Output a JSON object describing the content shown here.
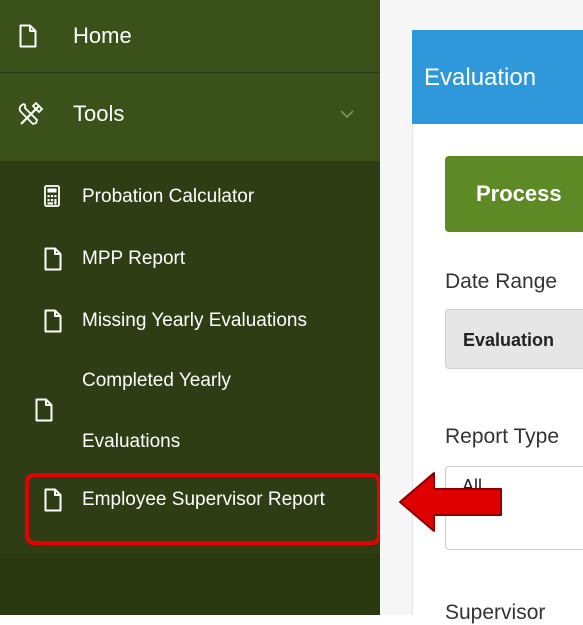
{
  "sidebar": {
    "home": {
      "label": "Home",
      "icon": "document-icon"
    },
    "tools": {
      "label": "Tools",
      "icon": "tools-icon",
      "expanded": true
    },
    "items": [
      {
        "label": "Probation Calculator",
        "icon": "calculator-icon"
      },
      {
        "label": "MPP Report",
        "icon": "document-icon"
      },
      {
        "label": "Missing Yearly Evaluations",
        "icon": "document-icon"
      },
      {
        "label_line1": "Completed Yearly",
        "label_line2": "Evaluations",
        "icon": "document-icon"
      },
      {
        "label": "Employee Supervisor Report",
        "icon": "document-icon",
        "highlighted": true
      }
    ]
  },
  "main": {
    "header_title": "Evaluation",
    "process_button": "Process",
    "date_range_label": "Date Range",
    "date_range_value": "Evaluation",
    "report_type_label": "Report Type",
    "report_type_value": "All",
    "supervisor_label": "Supervisor"
  },
  "colors": {
    "sidebar_bg": "#2f3d14",
    "sidebar_item_bg": "#3a5219",
    "header_blue": "#2f98db",
    "button_green": "#5d8a24",
    "highlight_red": "#e60000"
  }
}
